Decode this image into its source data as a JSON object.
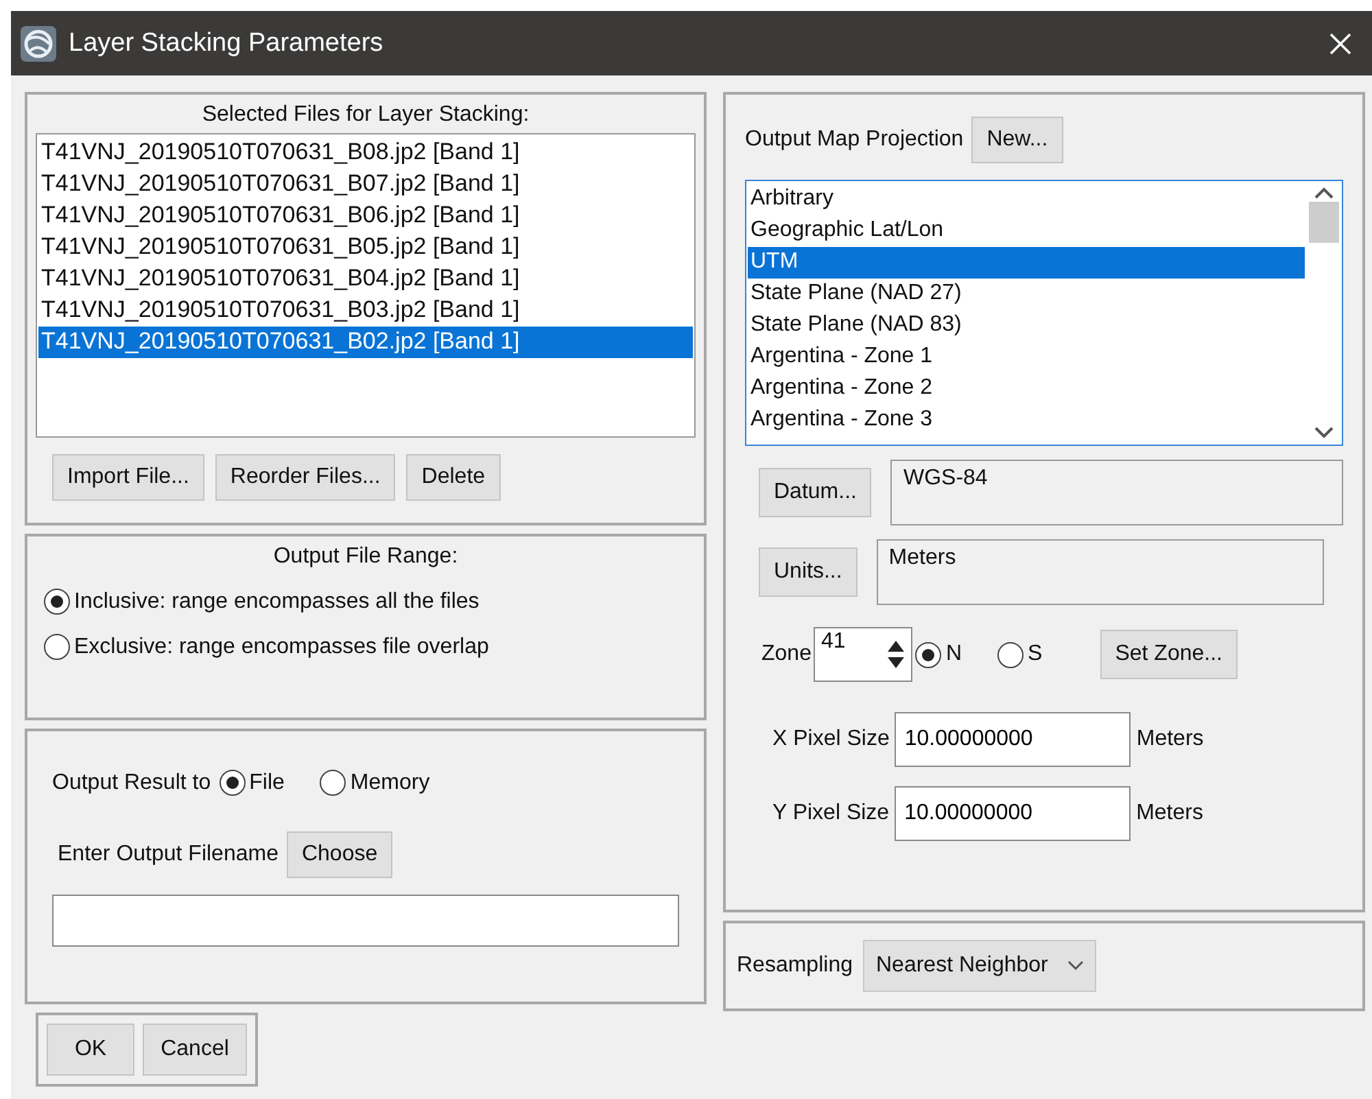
{
  "window": {
    "title": "Layer Stacking Parameters"
  },
  "files": {
    "title": "Selected Files for Layer Stacking:",
    "items": [
      {
        "label": "T41VNJ_20190510T070631_B08.jp2 [Band 1]",
        "selected": false
      },
      {
        "label": "T41VNJ_20190510T070631_B07.jp2 [Band 1]",
        "selected": false
      },
      {
        "label": "T41VNJ_20190510T070631_B06.jp2 [Band 1]",
        "selected": false
      },
      {
        "label": "T41VNJ_20190510T070631_B05.jp2 [Band 1]",
        "selected": false
      },
      {
        "label": "T41VNJ_20190510T070631_B04.jp2 [Band 1]",
        "selected": false
      },
      {
        "label": "T41VNJ_20190510T070631_B03.jp2 [Band 1]",
        "selected": false
      },
      {
        "label": "T41VNJ_20190510T070631_B02.jp2 [Band 1]",
        "selected": true
      }
    ],
    "buttons": [
      "Import File...",
      "Reorder Files...",
      "Delete"
    ]
  },
  "range": {
    "title": "Output File Range:",
    "options": [
      {
        "label": "Inclusive: range encompasses all the files",
        "selected": true
      },
      {
        "label": "Exclusive: range encompasses file overlap",
        "selected": false
      }
    ]
  },
  "output": {
    "label": "Output Result to",
    "options": [
      {
        "label": "File",
        "selected": true
      },
      {
        "label": "Memory",
        "selected": false
      }
    ],
    "filename_label": "Enter Output Filename",
    "choose_button": "Choose"
  },
  "dialog_buttons": [
    "OK",
    "Cancel"
  ],
  "projection": {
    "label": "Output Map Projection",
    "new_button": "New...",
    "items": [
      {
        "label": "Arbitrary",
        "selected": false
      },
      {
        "label": "Geographic Lat/Lon",
        "selected": false
      },
      {
        "label": "UTM",
        "selected": true
      },
      {
        "label": "State Plane (NAD 27)",
        "selected": false
      },
      {
        "label": "State Plane (NAD 83)",
        "selected": false
      },
      {
        "label": "Argentina - Zone 1",
        "selected": false
      },
      {
        "label": "Argentina - Zone 2",
        "selected": false
      },
      {
        "label": "Argentina - Zone 3",
        "selected": false
      }
    ],
    "datum_button": "Datum...",
    "datum": "WGS-84",
    "units_button": "Units...",
    "units": "Meters",
    "zone_label": "Zone",
    "zone": "41",
    "hemispheres": [
      {
        "label": "N",
        "selected": true
      },
      {
        "label": "S",
        "selected": false
      }
    ],
    "set_zone_button": "Set Zone...",
    "pixel_sizes": [
      {
        "label": "X Pixel Size",
        "value": "10.00000000",
        "unit": "Meters"
      },
      {
        "label": "Y Pixel Size",
        "value": "10.00000000",
        "unit": "Meters"
      }
    ]
  },
  "resampling": {
    "label": "Resampling",
    "value": "Nearest Neighbor"
  }
}
